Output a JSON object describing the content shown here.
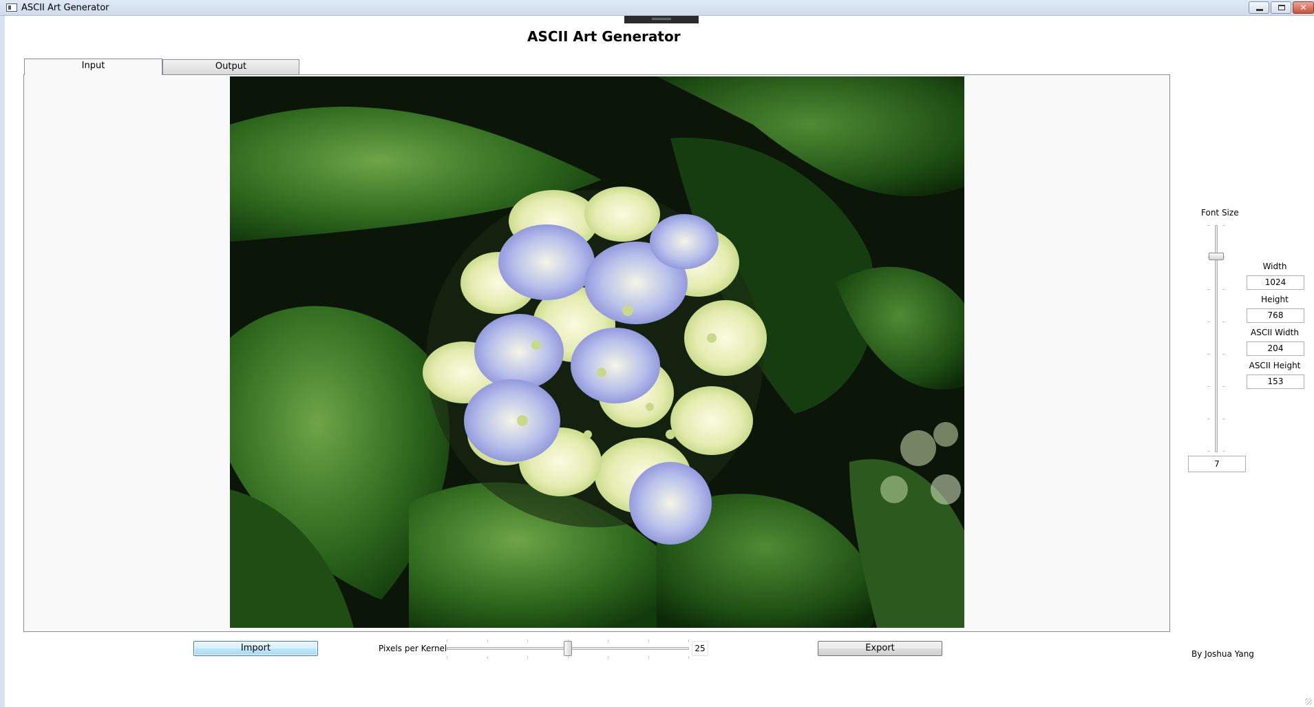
{
  "window": {
    "title": "ASCII Art Generator",
    "controls": [
      "minimize",
      "maximize",
      "close"
    ]
  },
  "header": {
    "title": "ASCII Art Generator"
  },
  "tabs": [
    {
      "label": "Input",
      "active": true
    },
    {
      "label": "Output",
      "active": false
    }
  ],
  "input_image": {
    "description_icon": "image-preview"
  },
  "font_size": {
    "label": "Font Size",
    "value": "7"
  },
  "dimensions": {
    "width_label": "Width",
    "width_value": "1024",
    "height_label": "Height",
    "height_value": "768",
    "ascii_width_label": "ASCII Width",
    "ascii_width_value": "204",
    "ascii_height_label": "ASCII Height",
    "ascii_height_value": "153"
  },
  "bottom": {
    "import_label": "Import",
    "ppk_label": "Pixels per Kernel",
    "ppk_value": "25",
    "export_label": "Export"
  },
  "credit": "By Joshua Yang",
  "colors": {
    "accent_button": "#bee6fd",
    "panel_bg": "#f9f9f9",
    "titlebar": "#dfe9f5"
  }
}
